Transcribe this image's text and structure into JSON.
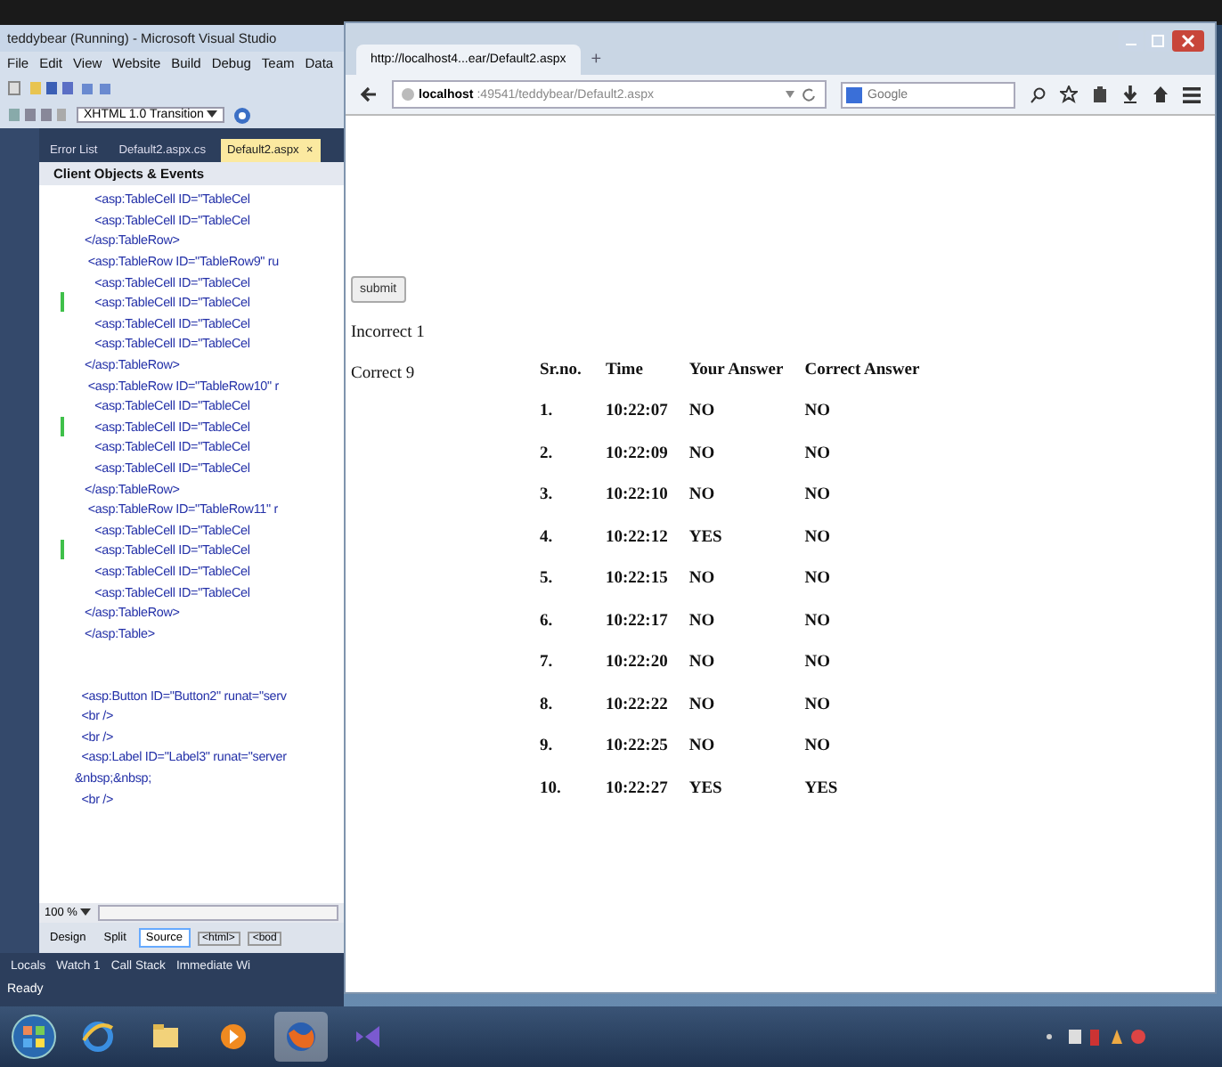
{
  "ide": {
    "title": "teddybear (Running) - Microsoft Visual Studio",
    "menu": [
      "File",
      "Edit",
      "View",
      "Website",
      "Build",
      "Debug",
      "Team",
      "Data"
    ],
    "doctype_dropdown": "XHTML 1.0 Transition",
    "tabs": [
      {
        "label": "Error List",
        "selected": false
      },
      {
        "label": "Default2.aspx.cs",
        "selected": false
      },
      {
        "label": "Default2.aspx",
        "selected": true
      }
    ],
    "tab_close": "×",
    "object_bar": "Client Objects & Events",
    "code_lines": [
      {
        "kind": "code",
        "text": "      <asp:TableCell ID=\"TableCel",
        "changed": false
      },
      {
        "kind": "code",
        "text": "      <asp:TableCell ID=\"TableCel",
        "changed": false
      },
      {
        "kind": "code",
        "text": "   </asp:TableRow>",
        "changed": false
      },
      {
        "kind": "code",
        "text": "    <asp:TableRow ID=\"TableRow9\" ru",
        "changed": false
      },
      {
        "kind": "code",
        "text": "      <asp:TableCell ID=\"TableCel",
        "changed": false
      },
      {
        "kind": "code",
        "text": "      <asp:TableCell ID=\"TableCel",
        "changed": true
      },
      {
        "kind": "code",
        "text": "      <asp:TableCell ID=\"TableCel",
        "changed": false
      },
      {
        "kind": "code",
        "text": "      <asp:TableCell ID=\"TableCel",
        "changed": false
      },
      {
        "kind": "code",
        "text": "   </asp:TableRow>",
        "changed": false
      },
      {
        "kind": "code",
        "text": "    <asp:TableRow ID=\"TableRow10\" r",
        "changed": false
      },
      {
        "kind": "code",
        "text": "      <asp:TableCell ID=\"TableCel",
        "changed": false
      },
      {
        "kind": "code",
        "text": "      <asp:TableCell ID=\"TableCel",
        "changed": true
      },
      {
        "kind": "code",
        "text": "      <asp:TableCell ID=\"TableCel",
        "changed": false
      },
      {
        "kind": "code",
        "text": "      <asp:TableCell ID=\"TableCel",
        "changed": false
      },
      {
        "kind": "code",
        "text": "   </asp:TableRow>",
        "changed": false
      },
      {
        "kind": "code",
        "text": "    <asp:TableRow ID=\"TableRow11\" r",
        "changed": false
      },
      {
        "kind": "code",
        "text": "      <asp:TableCell ID=\"TableCel",
        "changed": false
      },
      {
        "kind": "code",
        "text": "      <asp:TableCell ID=\"TableCel",
        "changed": true
      },
      {
        "kind": "code",
        "text": "      <asp:TableCell ID=\"TableCel",
        "changed": false
      },
      {
        "kind": "code",
        "text": "      <asp:TableCell ID=\"TableCel",
        "changed": false
      },
      {
        "kind": "code",
        "text": "   </asp:TableRow>",
        "changed": false
      },
      {
        "kind": "code",
        "text": "   </asp:Table>",
        "changed": false
      },
      {
        "kind": "blank",
        "changed": false
      },
      {
        "kind": "blank",
        "changed": false
      },
      {
        "kind": "code",
        "text": "  <asp:Button ID=\"Button2\" runat=\"serv",
        "changed": false
      },
      {
        "kind": "code",
        "text": "  <br />",
        "changed": false
      },
      {
        "kind": "code",
        "text": "  <br />",
        "changed": false
      },
      {
        "kind": "code",
        "text": "  <asp:Label ID=\"Label3\" runat=\"server",
        "changed": false
      },
      {
        "kind": "code",
        "text": "&nbsp;&nbsp;",
        "changed": false
      },
      {
        "kind": "code",
        "text": "  <br />",
        "changed": false
      }
    ],
    "zoom": "100 %",
    "views": [
      {
        "label": "Design",
        "selected": false
      },
      {
        "label": "Split",
        "selected": false
      },
      {
        "label": "Source",
        "selected": true
      }
    ],
    "breadcrumbs": [
      "<html>",
      "<bod"
    ],
    "tool_tabs": [
      "Locals",
      "Watch 1",
      "Call Stack",
      "Immediate Wi"
    ],
    "status": "Ready"
  },
  "browser": {
    "tab": "http://localhost4...ear/Default2.aspx",
    "new_tab": "+",
    "url_host": "localhost",
    "url_path": ":49541/teddybear/Default2.aspx",
    "search": {
      "placeholder": "Google"
    },
    "page": {
      "button": "submit",
      "incorrect": "Incorrect 1",
      "correct": "Correct 9",
      "columns": [
        "Sr.no.",
        "Time",
        "Your Answer",
        "Correct Answer"
      ],
      "rows": [
        [
          "1.",
          "10:22:07",
          "NO",
          "NO"
        ],
        [
          "2.",
          "10:22:09",
          "NO",
          "NO"
        ],
        [
          "3.",
          "10:22:10",
          "NO",
          "NO"
        ],
        [
          "4.",
          "10:22:12",
          "YES",
          "NO"
        ],
        [
          "5.",
          "10:22:15",
          "NO",
          "NO"
        ],
        [
          "6.",
          "10:22:17",
          "NO",
          "NO"
        ],
        [
          "7.",
          "10:22:20",
          "NO",
          "NO"
        ],
        [
          "8.",
          "10:22:22",
          "NO",
          "NO"
        ],
        [
          "9.",
          "10:22:25",
          "NO",
          "NO"
        ],
        [
          "10.",
          "10:22:27",
          "YES",
          "YES"
        ]
      ]
    }
  },
  "taskbar": {
    "apps": [
      {
        "kind": "ie",
        "selected": false
      },
      {
        "kind": "folder",
        "selected": false
      },
      {
        "kind": "media",
        "selected": false
      },
      {
        "kind": "firefox",
        "selected": true
      },
      {
        "kind": "vs",
        "selected": false
      }
    ]
  }
}
